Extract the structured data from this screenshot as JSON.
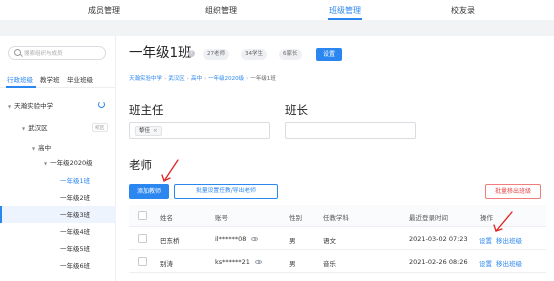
{
  "topnav": {
    "tabs": [
      {
        "label": "成员管理",
        "active": false
      },
      {
        "label": "组织管理",
        "active": false
      },
      {
        "label": "班级管理",
        "active": true
      },
      {
        "label": "校友录",
        "active": false
      }
    ]
  },
  "sidebar": {
    "search_placeholder": "搜索组织与成员",
    "tabs": [
      "行政班级",
      "教学班",
      "毕业班级"
    ],
    "tree": {
      "school": "天瀚实验中学",
      "district": "武汉区",
      "district_tag": "校区",
      "section": "高中",
      "grade": "一年级2020级"
    },
    "classes": [
      "一年级1班",
      "一年级2班",
      "一年级3班",
      "一年级4班",
      "一年级5班",
      "一年级6班"
    ],
    "selected_class": "一年级1班"
  },
  "header": {
    "title": "一年级1班",
    "hint": "?",
    "chips": [
      "27老师",
      "34学生",
      "6家长"
    ],
    "settings_label": "设置"
  },
  "breadcrumb": [
    "天瀚实验中学",
    "武汉区",
    "高中",
    "一年级2020级",
    "一年级1班"
  ],
  "class_teacher": {
    "heading": "班主任",
    "tag": "黎佳",
    "remove_symbol": "×"
  },
  "monitor": {
    "heading": "班长"
  },
  "teachers": {
    "heading": "老师",
    "add_label": "添加教师",
    "batch_label": "批量设置任教/导出老师",
    "batch_remove_label": "批量移出班级",
    "columns": [
      "姓名",
      "账号",
      "性别",
      "任教学科",
      "最近登录时间",
      "操作"
    ],
    "rows": [
      {
        "name": "巴东桥",
        "account": "il******08",
        "gender": "男",
        "subject": "语文",
        "last_login": "2021-03-02 07:23",
        "op_set": "设置",
        "op_remove": "移出班级"
      },
      {
        "name": "别涛",
        "account": "ks******21",
        "gender": "男",
        "subject": "音乐",
        "last_login": "2021-02-26 08:26",
        "op_set": "设置",
        "op_remove": "移出班级"
      }
    ]
  },
  "colors": {
    "accent": "#2b86f0",
    "danger": "#e5484d",
    "annotation_arrow": "#e02424"
  }
}
